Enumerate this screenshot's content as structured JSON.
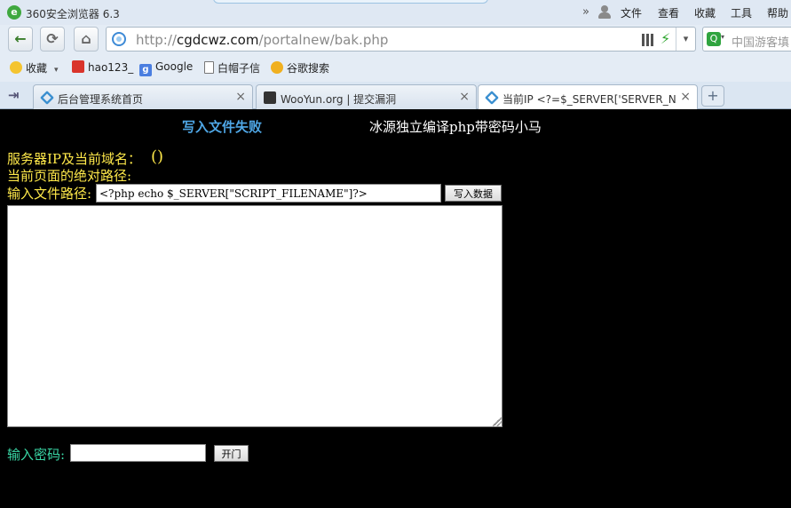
{
  "window": {
    "app_logo_letter": "e",
    "title": "360安全浏览器 6.3",
    "menu": {
      "more": "»",
      "file": "文件",
      "view": "查看",
      "favorites": "收藏",
      "tools": "工具",
      "help": "帮助"
    }
  },
  "navbar": {
    "back": "←",
    "refresh": "⟳",
    "home": "⌂",
    "url_host": "cgdcwz.com",
    "url_prefix": "http://",
    "url_path": "/portalnew/bak.php",
    "lightning": "⚡",
    "dropdown": "▾",
    "search_engine_letter": "Q",
    "search_text": "中国游客填"
  },
  "bookmarks": {
    "favorites": "收藏",
    "favorites_drop": "▾",
    "hao123": "hao123_",
    "google_letter": "g",
    "google": "Google",
    "bmzx": "白帽子信",
    "guge": "谷歌搜索"
  },
  "tabs": {
    "side_button": "⇥",
    "items": [
      {
        "label": "后台管理系统首页",
        "close": "×"
      },
      {
        "label": "WooYun.org | 提交漏洞",
        "close": "×"
      },
      {
        "label": "当前IP  <?=$_SERVER['SERVER_NA",
        "close": "×"
      }
    ],
    "new_tab": "+"
  },
  "page": {
    "fail_message": "写入文件失败",
    "heading": "冰源独立编译php带密码小马",
    "server_label": "服务器IP及当前域名：",
    "server_value": "()",
    "abs_path_label": "当前页面的绝对路径:",
    "file_path_label": "输入文件路径:",
    "file_path_value": "<?php echo $_SERVER[\"SCRIPT_FILENAME\"]?>",
    "write_button": "写入数据",
    "content_value": "",
    "password_label": "输入密码:",
    "open_button": "开门"
  },
  "colors": {
    "fail_message": "#4fa7e6",
    "yellow_labels": "#ffe94a",
    "password_label": "#3ad8a6",
    "page_background": "#000000"
  }
}
